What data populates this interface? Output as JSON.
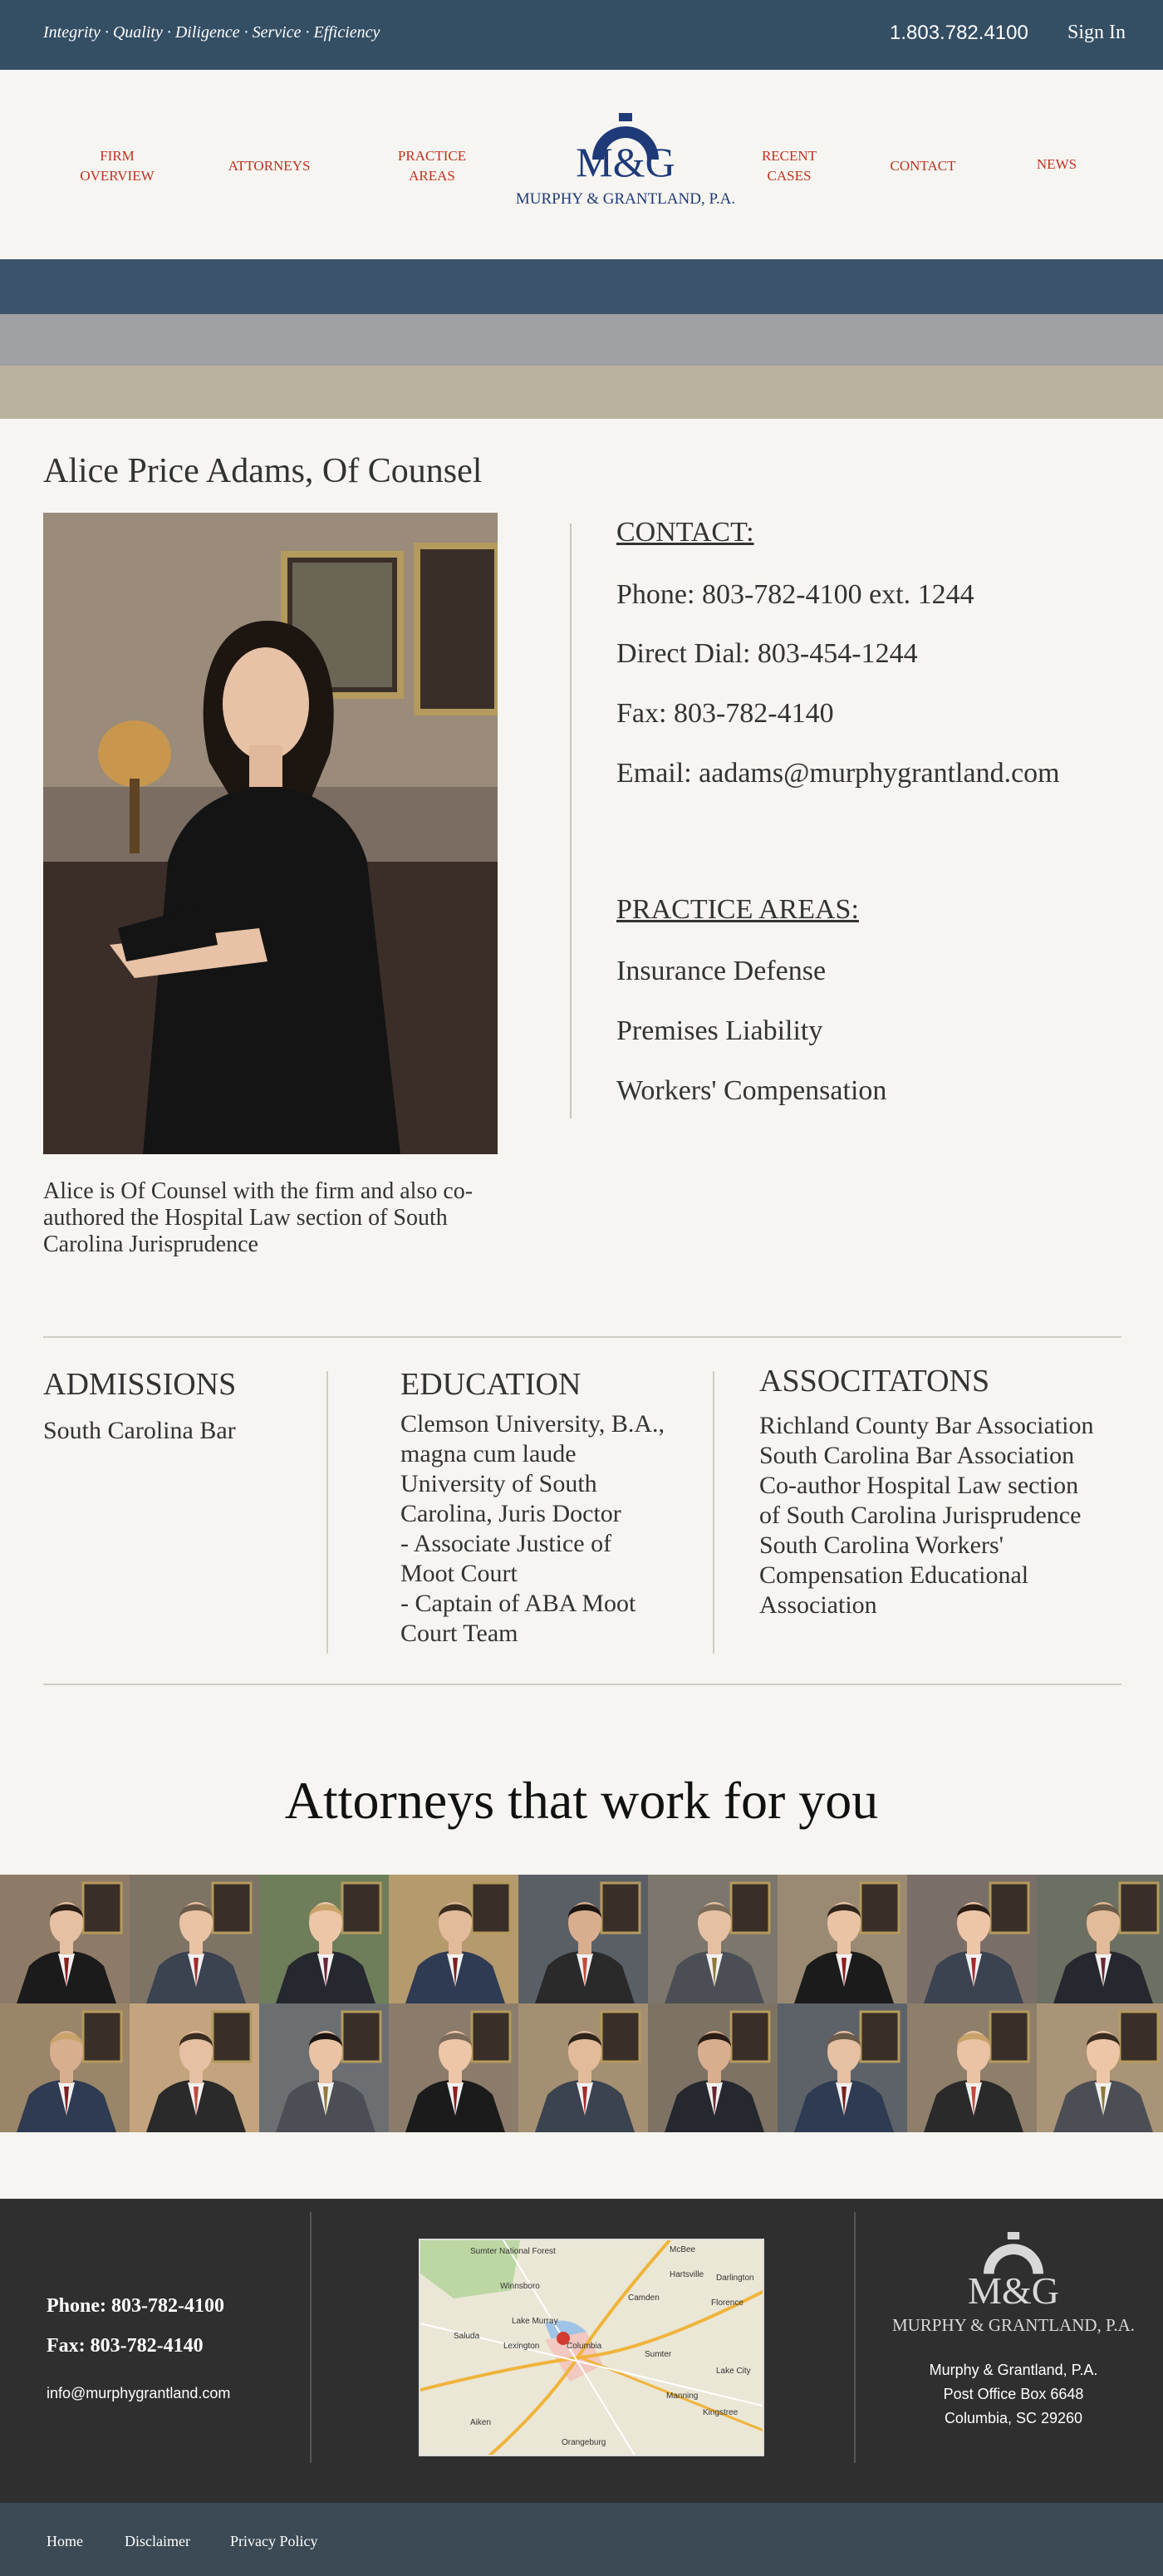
{
  "topbar": {
    "tagline": "Integrity · Quality · Diligence · Service · Efficiency",
    "phone": "1.803.782.4100",
    "signin": "Sign In"
  },
  "nav": {
    "firm_overview": [
      "FIRM",
      "OVERVIEW"
    ],
    "attorneys": "ATTORNEYS",
    "practice_areas": [
      "PRACTICE",
      "AREAS"
    ],
    "recent_cases": [
      "RECENT",
      "CASES"
    ],
    "contact": "CONTACT",
    "news": "NEWS"
  },
  "logo": {
    "initials": "M&G",
    "name": "MURPHY & GRANTLAND, P.A."
  },
  "profile": {
    "title": "Alice Price Adams, Of Counsel",
    "bio": "Alice is Of Counsel with the firm and also co-authored the Hospital Law section of South Carolina Jurisprudence"
  },
  "contact": {
    "heading": "CONTACT:",
    "phone": "Phone: 803-782-4100 ext. 1244",
    "direct": "Direct Dial: 803-454-1244",
    "fax": "Fax: 803-782-4140",
    "email": "Email: aadams@murphygrantland.com"
  },
  "practice": {
    "heading": "PRACTICE AREAS:",
    "items": [
      "Insurance Defense",
      "Premises Liability",
      "Workers' Compensation"
    ]
  },
  "admissions": {
    "heading": "ADMISSIONS",
    "lines": [
      "South Carolina Bar"
    ]
  },
  "education": {
    "heading": "EDUCATION",
    "lines": [
      "Clemson University, B.A.,",
      "magna cum laude",
      "University of South",
      "Carolina, Juris Doctor",
      "- Associate Justice of",
      "Moot Court",
      "- Captain of ABA Moot",
      "Court Team"
    ]
  },
  "associations": {
    "heading": "ASSOCITATONS",
    "lines": [
      "Richland County Bar Association",
      "South Carolina Bar Association",
      "Co-author Hospital Law section",
      "of South Carolina Jurisprudence",
      "South Carolina Workers'",
      "Compensation Educational",
      "Association"
    ]
  },
  "attorneys_section": {
    "title": "Attorneys that work for you"
  },
  "footer": {
    "phone_label": "Phone:",
    "phone": "803-782-4100",
    "fax_label": "Fax:",
    "fax": "803-782-4140",
    "email": "info@murphygrantland.com",
    "map_labels": [
      "Sumter National Forest",
      "McBee",
      "Winnsboro",
      "Camden",
      "Hartsville",
      "Darlington",
      "Florence",
      "Lake Murray",
      "Lexington",
      "Columbia",
      "Saluda",
      "Sumter",
      "Aiken",
      "Orangeburg",
      "Manning",
      "Kingstree",
      "Lake City"
    ],
    "logo_initials": "M&G",
    "logo_name": "MURPHY & GRANTLAND, P.A.",
    "addr1": "Murphy & Grantland, P.A.",
    "addr2": "Post Office Box 6648",
    "addr3": "Columbia, SC 29260"
  },
  "bottom_links": {
    "home": "Home",
    "disclaimer": "Disclaimer",
    "privacy": "Privacy Policy"
  },
  "colors": {
    "navy": "#344e64",
    "accent_red": "#c0311e",
    "logo_blue": "#1e3a78",
    "footer_bg": "#2f2f2f"
  }
}
